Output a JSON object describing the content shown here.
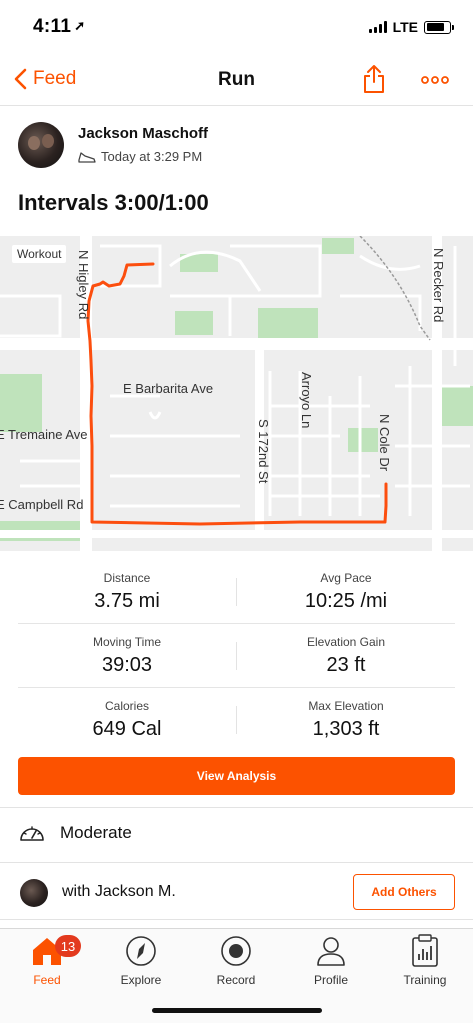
{
  "status_bar": {
    "time": "4:11",
    "network": "LTE"
  },
  "nav": {
    "back_label": "Feed",
    "title": "Run"
  },
  "athlete": {
    "name": "Jackson Maschoff",
    "time": "Today at 3:29 PM"
  },
  "activity": {
    "title": "Intervals 3:00/1:00"
  },
  "map": {
    "tag": "Workout",
    "streets": {
      "higley": "N Higley Rd",
      "recker": "N Recker Rd",
      "barbarita": "E Barbarita Ave",
      "tremaine": "E Tremaine Ave",
      "campbell": "E Campbell Rd",
      "arroyo": "Arroyo Ln",
      "s172": "S 172nd St",
      "cole": "N Cole Dr"
    }
  },
  "stats": {
    "distance": {
      "label": "Distance",
      "value": "3.75 mi"
    },
    "avg_pace": {
      "label": "Avg Pace",
      "value": "10:25 /mi"
    },
    "moving_time": {
      "label": "Moving Time",
      "value": "39:03"
    },
    "elevation_gain": {
      "label": "Elevation Gain",
      "value": "23 ft"
    },
    "calories": {
      "label": "Calories",
      "value": "649 Cal"
    },
    "max_elevation": {
      "label": "Max Elevation",
      "value": "1,303 ft"
    }
  },
  "actions": {
    "view_analysis": "View Analysis"
  },
  "effort": {
    "label": "Moderate"
  },
  "with": {
    "label": "with Jackson M.",
    "add_others": "Add Others"
  },
  "tabbar": {
    "feed": "Feed",
    "feed_badge": "13",
    "explore": "Explore",
    "record": "Record",
    "profile": "Profile",
    "training": "Training"
  },
  "colors": {
    "accent": "#fc5200",
    "badge": "#e33a1e",
    "map_green": "#bfe3bb"
  }
}
